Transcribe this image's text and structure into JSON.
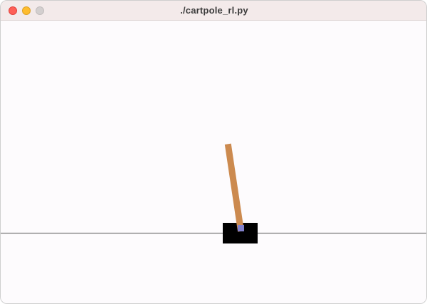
{
  "window": {
    "title": "./cartpole_rl.py",
    "traffic_lights": {
      "close": "#fe5f57",
      "minimize": "#febc2e",
      "zoom": "#d3cfcf"
    }
  },
  "scene": {
    "background": "#fdfbfd",
    "track_color": "#7a7a7a",
    "cart_color": "#000000",
    "pole_color": "#cc8a4f",
    "axle_color": "#8180cb"
  }
}
